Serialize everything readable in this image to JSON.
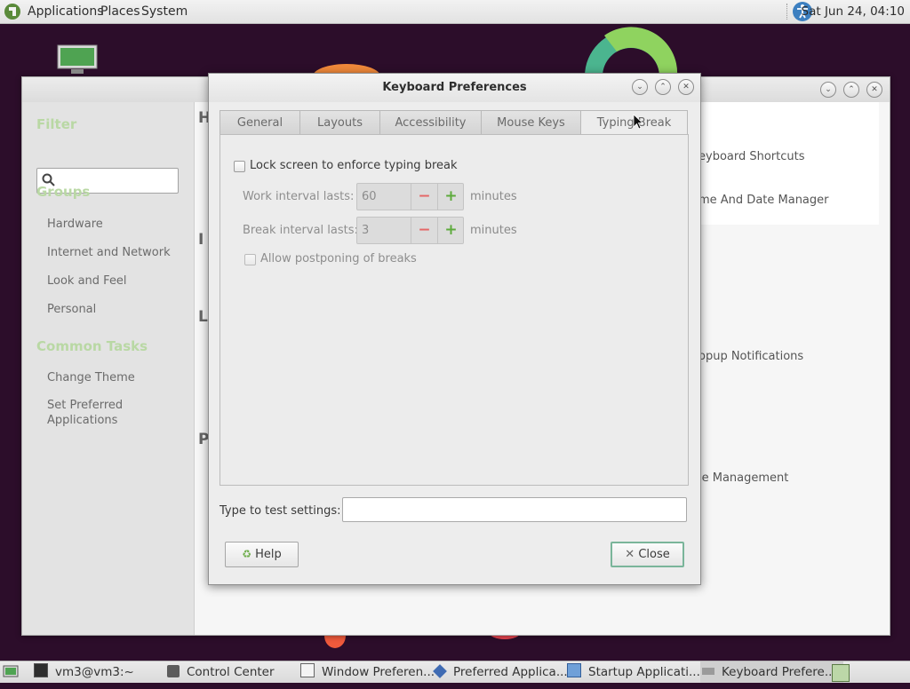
{
  "top_panel": {
    "menus": [
      "Applications",
      "Places",
      "System"
    ],
    "clock": "Sat Jun 24, 04:10"
  },
  "control_center": {
    "sidebar": {
      "filter_heading": "Filter",
      "groups_heading": "Groups",
      "groups": [
        "Hardware",
        "Internet and Network",
        "Look and Feel",
        "Personal"
      ],
      "tasks_heading": "Common Tasks",
      "tasks": [
        "Change Theme",
        "Set Preferred Applications"
      ]
    },
    "visible_items": [
      "eyboard Shortcuts",
      "me And Date Manager",
      "opup Notifications",
      "le Management"
    ],
    "section_letters": [
      "H",
      "I",
      "L",
      "P"
    ]
  },
  "dialog": {
    "title": "Keyboard Preferences",
    "tabs": [
      "General",
      "Layouts",
      "Accessibility",
      "Mouse Keys",
      "Typing Break"
    ],
    "active_tab": "Typing Break",
    "lock_screen_label": "Lock screen to enforce typing break",
    "lock_screen_checked": false,
    "work_interval": {
      "label": "Work interval lasts:",
      "value": "60",
      "unit": "minutes"
    },
    "break_interval": {
      "label": "Break interval lasts:",
      "value": "3",
      "unit": "minutes"
    },
    "postpone_label": "Allow postponing of breaks",
    "postpone_checked": false,
    "test_label": "Type to test settings:",
    "test_value": "",
    "help_label": "Help",
    "close_label": "Close"
  },
  "taskbar": {
    "items": [
      "vm3@vm3:~",
      "Control Center",
      "Window Preferen...",
      "Preferred Applica...",
      "Startup Applicati...",
      "Keyboard Prefere..."
    ]
  },
  "colors": {
    "desktop_bg": "#2c0d2a",
    "sidebar_heading": "#b9d8a4",
    "plus_green": "#5daa3c",
    "minus_red": "#e56767"
  }
}
